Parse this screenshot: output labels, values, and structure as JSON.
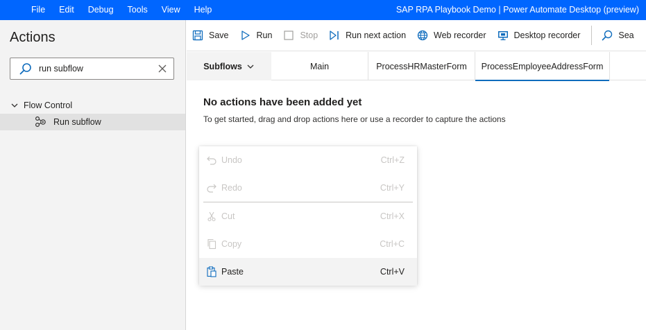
{
  "menu": {
    "items": [
      "File",
      "Edit",
      "Debug",
      "Tools",
      "View",
      "Help"
    ]
  },
  "app_title": "SAP RPA Playbook Demo | Power Automate Desktop (preview)",
  "actions_pane": {
    "title": "Actions",
    "search_value": "run subflow",
    "group_label": "Flow Control",
    "item_label": "Run subflow"
  },
  "toolbar": {
    "save": "Save",
    "run": "Run",
    "stop": "Stop",
    "run_next": "Run next action",
    "web_recorder": "Web recorder",
    "desktop_recorder": "Desktop recorder",
    "search": "Sea"
  },
  "tabs": {
    "subflows": "Subflows",
    "items": [
      "Main",
      "ProcessHRMasterForm",
      "ProcessEmployeeAddressForm"
    ],
    "active_index": 2
  },
  "canvas": {
    "empty_title": "No actions have been added yet",
    "empty_subtitle": "To get started, drag and drop actions here or use a recorder to capture the actions"
  },
  "context_menu": {
    "items": [
      {
        "label": "Undo",
        "shortcut": "Ctrl+Z",
        "enabled": false
      },
      {
        "label": "Redo",
        "shortcut": "Ctrl+Y",
        "enabled": false
      },
      {
        "label": "Cut",
        "shortcut": "Ctrl+X",
        "enabled": false
      },
      {
        "label": "Copy",
        "shortcut": "Ctrl+C",
        "enabled": false
      },
      {
        "label": "Paste",
        "shortcut": "Ctrl+V",
        "enabled": true
      }
    ]
  },
  "colors": {
    "title_bar": "#0066ff",
    "accent": "#0f6cbd",
    "pane_bg": "#f3f3f3",
    "disabled_text": "#c8c6c4"
  }
}
